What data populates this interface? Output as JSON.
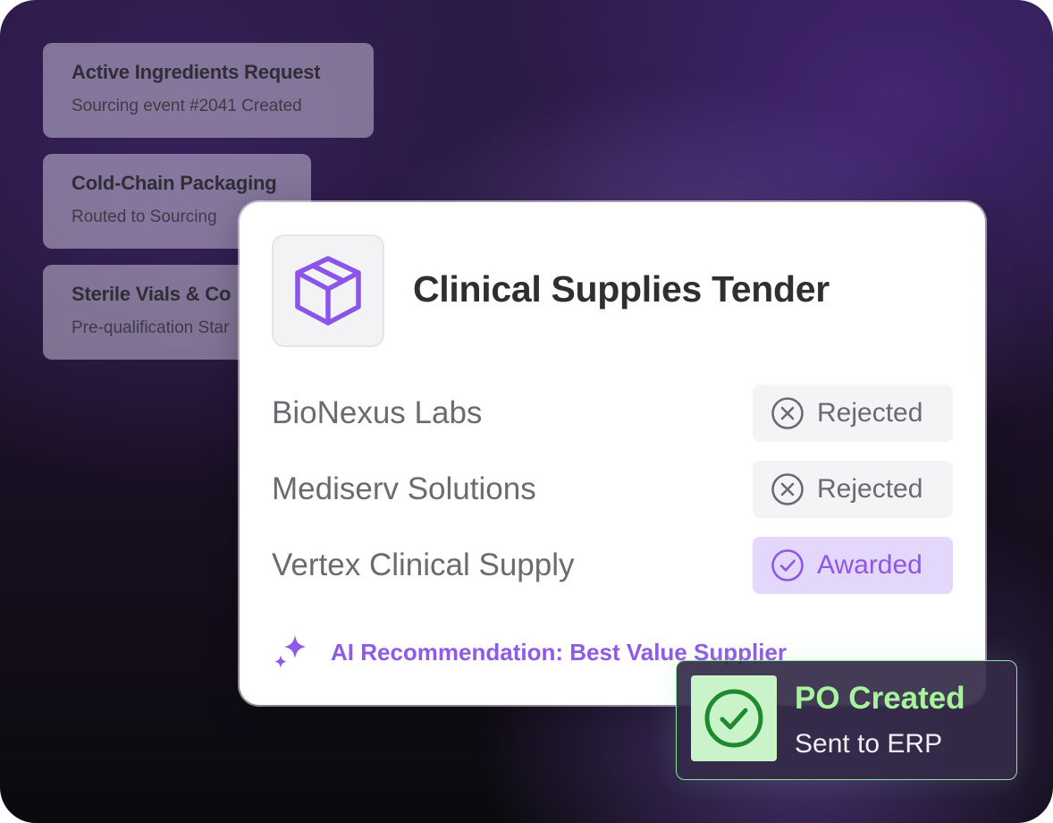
{
  "requests": [
    {
      "title": "Active Ingredients Request",
      "subtitle": "Sourcing event #2041 Created"
    },
    {
      "title": "Cold-Chain Packaging",
      "subtitle": "Routed to Sourcing"
    },
    {
      "title": "Sterile Vials & Co",
      "subtitle": "Pre-qualification Star"
    }
  ],
  "tender": {
    "icon": "package-box-icon",
    "title": "Clinical Supplies Tender",
    "suppliers": [
      {
        "name": "BioNexus Labs",
        "status": "Rejected",
        "status_icon": "x-circle-icon"
      },
      {
        "name": "Mediserv Solutions",
        "status": "Rejected",
        "status_icon": "x-circle-icon"
      },
      {
        "name": "Vertex Clinical Supply",
        "status": "Awarded",
        "status_icon": "check-circle-icon"
      }
    ],
    "ai_recommendation": "AI Recommendation: Best Value Supplier",
    "ai_icon": "sparkle-icon"
  },
  "toast": {
    "icon": "check-circle-icon",
    "title": "PO Created",
    "subtitle": "Sent to ERP"
  },
  "colors": {
    "accent_purple": "#8f5ae8",
    "awarded_bg": "#e3d7fb",
    "success_green": "#a6f59c",
    "success_icon_bg": "#c9f3c9"
  }
}
